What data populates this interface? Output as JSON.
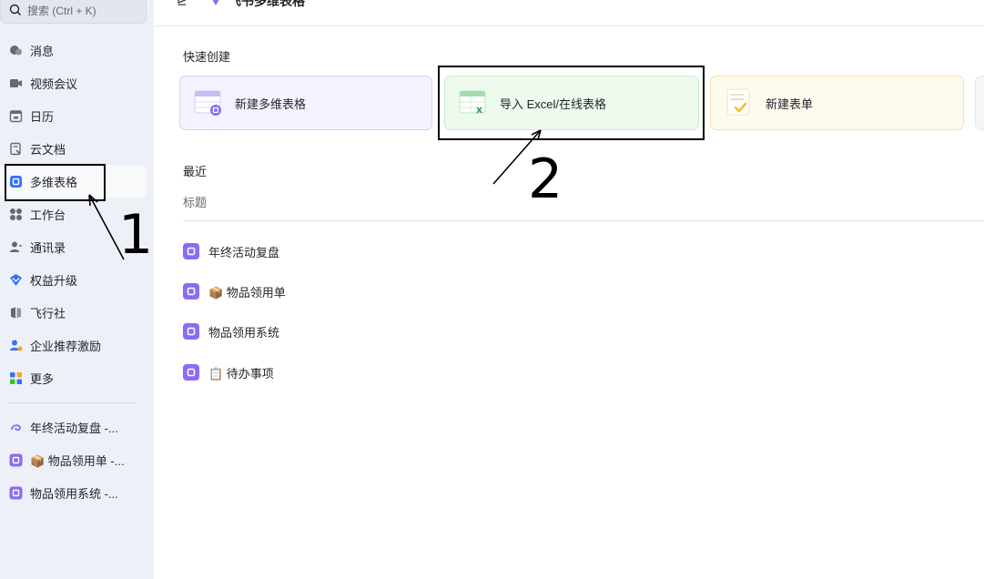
{
  "search": {
    "placeholder": "搜索 (Ctrl + K)"
  },
  "topbar": {
    "title": "飞书多维表格"
  },
  "sidebar": {
    "items": [
      {
        "label": "消息",
        "icon": "message-icon"
      },
      {
        "label": "视频会议",
        "icon": "video-icon"
      },
      {
        "label": "日历",
        "icon": "calendar-icon"
      },
      {
        "label": "云文档",
        "icon": "docs-icon"
      },
      {
        "label": "多维表格",
        "icon": "bitable-icon",
        "active": true
      },
      {
        "label": "工作台",
        "icon": "workplace-icon"
      },
      {
        "label": "通讯录",
        "icon": "contacts-icon"
      },
      {
        "label": "权益升级",
        "icon": "upgrade-icon"
      },
      {
        "label": "飞行社",
        "icon": "community-icon"
      },
      {
        "label": "企业推荐激励",
        "icon": "referral-icon"
      },
      {
        "label": "更多",
        "icon": "more-icon"
      }
    ],
    "recent": [
      {
        "label": "年终活动复盘 -..."
      },
      {
        "label": "📦 物品领用单 -..."
      },
      {
        "label": "物品领用系统 -..."
      }
    ]
  },
  "main": {
    "quick_create_title": "快速创建",
    "quick_create": [
      {
        "label": "新建多维表格",
        "icon": "new-bitable-icon",
        "bg": "#f5f2ff",
        "border": "#d8cff7"
      },
      {
        "label": "导入 Excel/在线表格",
        "icon": "excel-import-icon",
        "bg": "#eefaee",
        "border": "#c7ebc9"
      },
      {
        "label": "新建表单",
        "icon": "form-icon",
        "bg": "#fffaee",
        "border": "#f6e2a8"
      }
    ],
    "recent_title": "最近",
    "column_header": "标题",
    "recent": [
      {
        "label": "年终活动复盘"
      },
      {
        "label": "📦 物品领用单"
      },
      {
        "label": "物品领用系统"
      },
      {
        "label": "📋 待办事项"
      }
    ]
  },
  "annotations": {
    "one": "1",
    "two": "2"
  },
  "colors": {
    "accent": "#8b6cf0",
    "sidebar_bg": "#edf0f7",
    "excel_green": "#2e9e4f"
  }
}
